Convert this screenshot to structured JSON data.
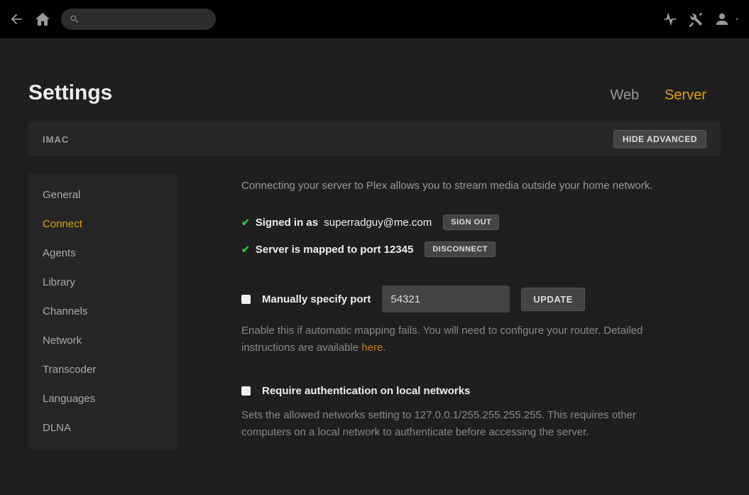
{
  "search": {
    "placeholder": ""
  },
  "header": {
    "title": "Settings",
    "tabs": {
      "web": "Web",
      "server": "Server"
    }
  },
  "server_bar": {
    "name": "IMAC",
    "hide_advanced": "Hide Advanced"
  },
  "sidebar": {
    "items": [
      {
        "label": "General"
      },
      {
        "label": "Connect"
      },
      {
        "label": "Agents"
      },
      {
        "label": "Library"
      },
      {
        "label": "Channels"
      },
      {
        "label": "Network"
      },
      {
        "label": "Transcoder"
      },
      {
        "label": "Languages"
      },
      {
        "label": "DLNA"
      }
    ]
  },
  "content": {
    "intro": "Connecting your server to Plex allows you to stream media outside your home network.",
    "signed_in_prefix": "Signed in as",
    "signed_in_user": "superradguy@me.com",
    "sign_out": "Sign Out",
    "mapped": "Server is mapped to port 12345",
    "disconnect": "Disconnect",
    "manual_port_label": "Manually specify port",
    "manual_port_value": "54321",
    "update": "Update",
    "manual_port_help_pre": "Enable this if automatic mapping fails. You will need to configure your router. Detailed instructions are available ",
    "manual_port_help_link": "here",
    "manual_port_help_post": ".",
    "require_auth_label": "Require authentication on local networks",
    "require_auth_help": "Sets the allowed networks setting to 127.0.0.1/255.255.255.255. This requires other computers on a local network to authenticate before accessing the server."
  }
}
